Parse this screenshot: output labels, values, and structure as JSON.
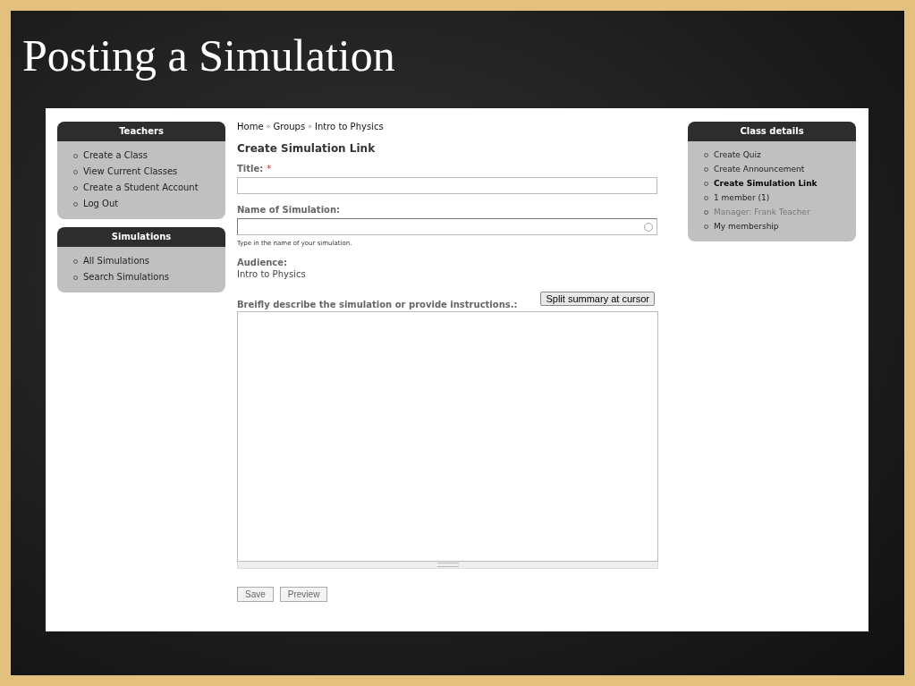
{
  "slide_title": "Posting a Simulation",
  "left_blocks": [
    {
      "title": "Teachers",
      "items": [
        {
          "label": "Create a Class"
        },
        {
          "label": "View Current Classes"
        },
        {
          "label": "Create a Student Account"
        },
        {
          "label": "Log Out"
        }
      ]
    },
    {
      "title": "Simulations",
      "items": [
        {
          "label": "All Simulations"
        },
        {
          "label": "Search Simulations"
        }
      ]
    }
  ],
  "breadcrumb": [
    {
      "label": "Home"
    },
    {
      "label": "Groups"
    },
    {
      "label": "Intro to Physics"
    }
  ],
  "breadcrumb_separator": "»",
  "page_title": "Create Simulation Link",
  "form": {
    "title_field": {
      "label": "Title:",
      "required_mark": "*"
    },
    "name_field": {
      "label": "Name of Simulation:",
      "help": "Type in the name of your simulation."
    },
    "audience": {
      "label": "Audience:",
      "value": "Intro to Physics"
    },
    "description": {
      "label": "Breifly describe the simulation or provide instructions.:",
      "split_button": "Split summary at cursor"
    },
    "buttons": [
      "Save",
      "Preview"
    ]
  },
  "right_block": {
    "title": "Class details",
    "items": [
      {
        "label": "Create Quiz",
        "kind": "link",
        "selected": false
      },
      {
        "label": "Create Announcement",
        "kind": "link",
        "selected": false
      },
      {
        "label": "Create Simulation Link",
        "kind": "link",
        "selected": true
      },
      {
        "label": "1 member (1)",
        "kind": "link",
        "selected": false
      },
      {
        "label": "Manager: Frank Teacher",
        "kind": "info",
        "selected": false
      },
      {
        "label": "My membership",
        "kind": "link",
        "selected": false
      }
    ]
  }
}
